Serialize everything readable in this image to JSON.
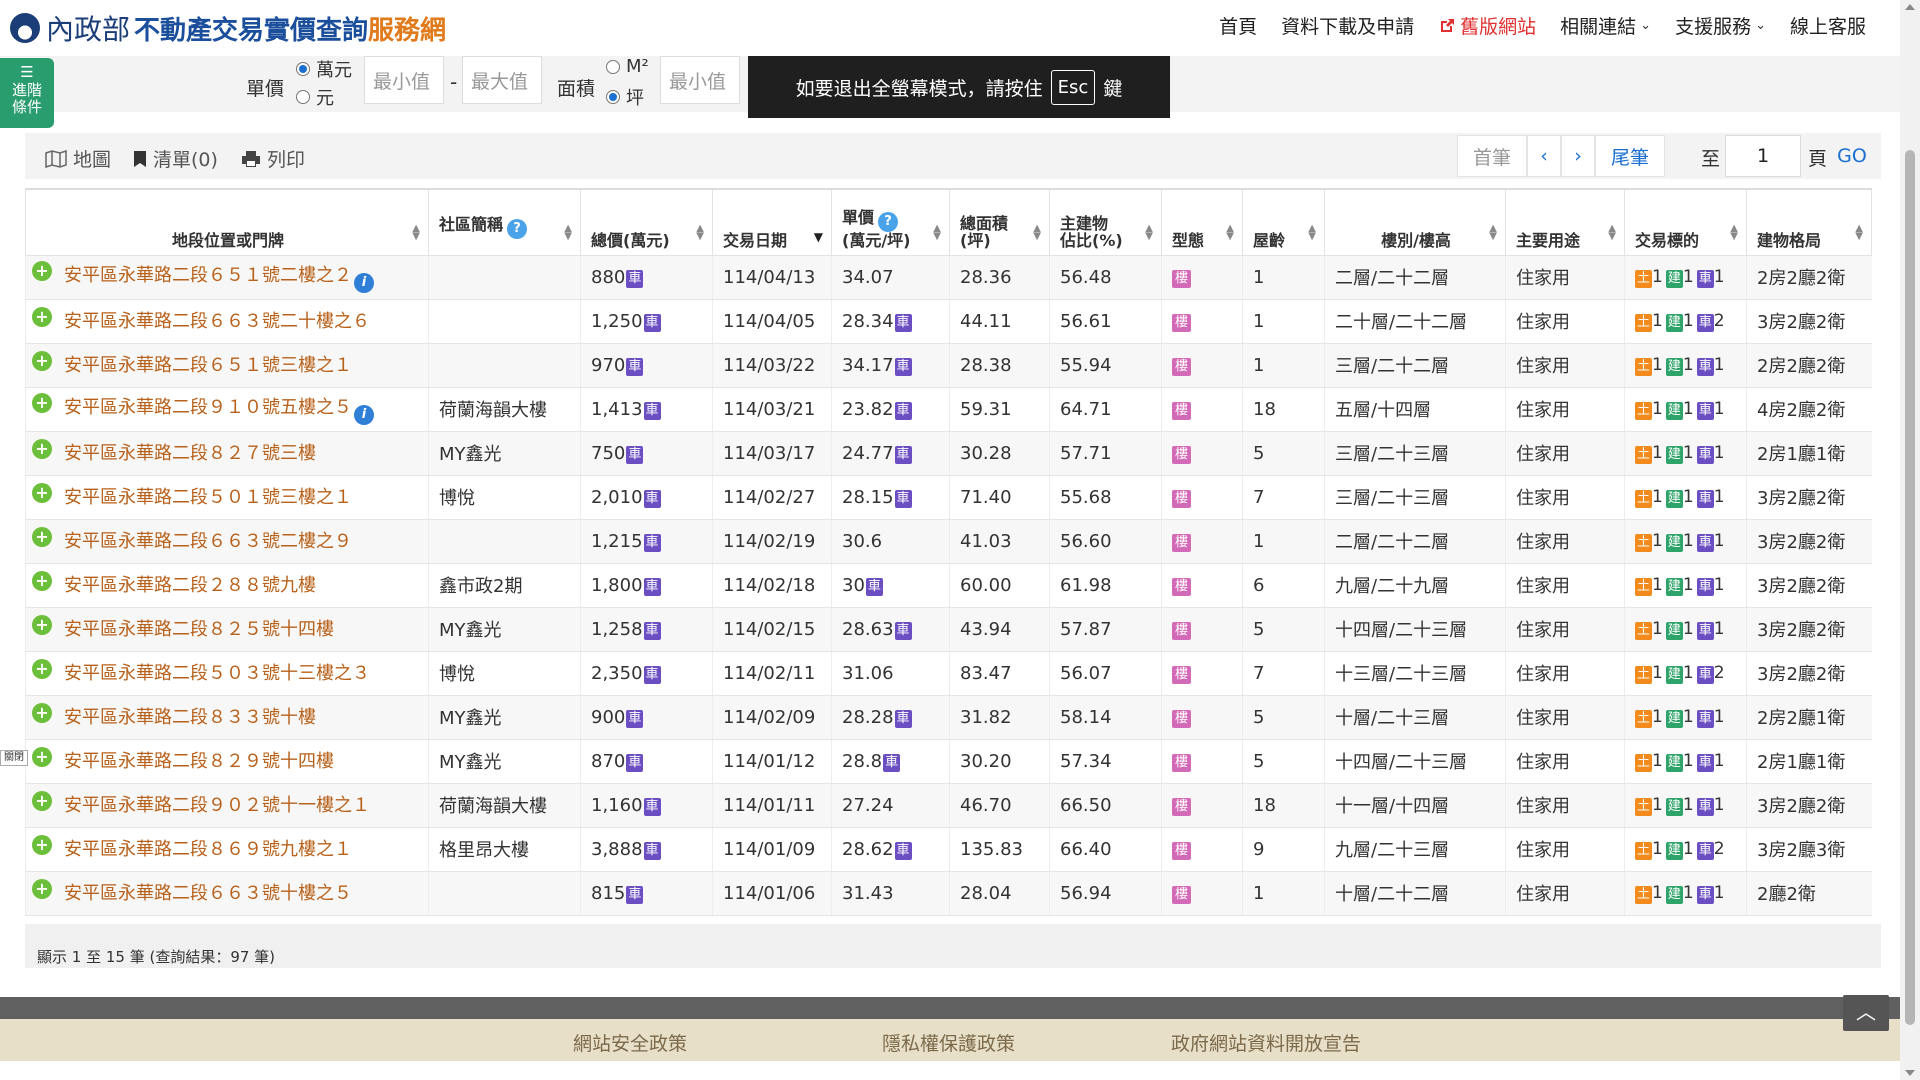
{
  "header": {
    "ministry": "內政部",
    "site_name": "不動產交易實價查詢",
    "site_suffix": "服務網",
    "nav": [
      {
        "label": "首頁"
      },
      {
        "label": "資料下載及申請"
      },
      {
        "label": "舊版網站"
      },
      {
        "label": "相關連結"
      },
      {
        "label": "支援服務"
      },
      {
        "label": "線上客服"
      }
    ]
  },
  "advanced": {
    "label_line1": "進階",
    "label_line2": "條件"
  },
  "filter": {
    "unit_price_label": "單價",
    "unit_wan": "萬元",
    "unit_yuan": "元",
    "min_placeholder": "最小值",
    "max_placeholder": "最大值",
    "dash": "-",
    "area_label": "面積",
    "area_m2": "M²",
    "area_ping": "坪",
    "area_min_placeholder": "最小值"
  },
  "fullscreen": {
    "text_before": "如要退出全螢幕模式，請按住",
    "key": "Esc",
    "text_after": "鍵"
  },
  "toolbar": {
    "map": "地圖",
    "list": "清單(0)",
    "print": "列印",
    "first": "首筆",
    "prev": "‹",
    "next": "›",
    "last": "尾筆",
    "to": "至",
    "page_value": "1",
    "page": "頁",
    "go": "GO"
  },
  "table": {
    "headers": {
      "address": "地段位置或門牌",
      "community": "社區簡稱",
      "total": "總價(萬元)",
      "date": "交易日期",
      "unit_line1": "單價",
      "unit_line2": "(萬元/坪)",
      "area_line1": "總面積",
      "area_line2": "(坪)",
      "main_line1": "主建物",
      "main_line2": "佔比(%)",
      "type": "型態",
      "age": "屋齡",
      "floor": "樓別/樓高",
      "usage": "主要用途",
      "target": "交易標的",
      "layout": "建物格局"
    },
    "badges": {
      "car": "車",
      "bldg": "樓",
      "land": "土",
      "build": "建"
    },
    "rows": [
      {
        "address": "安平區永華路二段６５１號二樓之２",
        "info": true,
        "community": "",
        "total": "880",
        "total_car": true,
        "date": "114/04/13",
        "unit": "34.07",
        "unit_car": false,
        "area": "28.36",
        "main": "56.48",
        "age": "1",
        "floor": "二層/二十二層",
        "usage": "住家用",
        "land": "1",
        "build": "1",
        "car": "1",
        "layout": "2房2廳2衛"
      },
      {
        "address": "安平區永華路二段６６３號二十樓之６",
        "info": false,
        "community": "",
        "total": "1,250",
        "total_car": true,
        "date": "114/04/05",
        "unit": "28.34",
        "unit_car": true,
        "area": "44.11",
        "main": "56.61",
        "age": "1",
        "floor": "二十層/二十二層",
        "usage": "住家用",
        "land": "1",
        "build": "1",
        "car": "2",
        "layout": "3房2廳2衛"
      },
      {
        "address": "安平區永華路二段６５１號三樓之１",
        "info": false,
        "community": "",
        "total": "970",
        "total_car": true,
        "date": "114/03/22",
        "unit": "34.17",
        "unit_car": true,
        "area": "28.38",
        "main": "55.94",
        "age": "1",
        "floor": "三層/二十二層",
        "usage": "住家用",
        "land": "1",
        "build": "1",
        "car": "1",
        "layout": "2房2廳2衛"
      },
      {
        "address": "安平區永華路二段９１０號五樓之５",
        "info": true,
        "community": "荷蘭海韻大樓",
        "total": "1,413",
        "total_car": true,
        "date": "114/03/21",
        "unit": "23.82",
        "unit_car": true,
        "area": "59.31",
        "main": "64.71",
        "age": "18",
        "floor": "五層/十四層",
        "usage": "住家用",
        "land": "1",
        "build": "1",
        "car": "1",
        "layout": "4房2廳2衛"
      },
      {
        "address": "安平區永華路二段８２７號三樓",
        "info": false,
        "community": "MY鑫光",
        "total": "750",
        "total_car": true,
        "date": "114/03/17",
        "unit": "24.77",
        "unit_car": true,
        "area": "30.28",
        "main": "57.71",
        "age": "5",
        "floor": "三層/二十三層",
        "usage": "住家用",
        "land": "1",
        "build": "1",
        "car": "1",
        "layout": "2房1廳1衛"
      },
      {
        "address": "安平區永華路二段５０１號三樓之１",
        "info": false,
        "community": "博悅",
        "total": "2,010",
        "total_car": true,
        "date": "114/02/27",
        "unit": "28.15",
        "unit_car": true,
        "area": "71.40",
        "main": "55.68",
        "age": "7",
        "floor": "三層/二十三層",
        "usage": "住家用",
        "land": "1",
        "build": "1",
        "car": "1",
        "layout": "3房2廳2衛"
      },
      {
        "address": "安平區永華路二段６６３號二樓之９",
        "info": false,
        "community": "",
        "total": "1,215",
        "total_car": true,
        "date": "114/02/19",
        "unit": "30.6",
        "unit_car": false,
        "area": "41.03",
        "main": "56.60",
        "age": "1",
        "floor": "二層/二十二層",
        "usage": "住家用",
        "land": "1",
        "build": "1",
        "car": "1",
        "layout": "3房2廳2衛"
      },
      {
        "address": "安平區永華路二段２８８號九樓",
        "info": false,
        "community": "鑫市政2期",
        "total": "1,800",
        "total_car": true,
        "date": "114/02/18",
        "unit": "30",
        "unit_car": true,
        "area": "60.00",
        "main": "61.98",
        "age": "6",
        "floor": "九層/二十九層",
        "usage": "住家用",
        "land": "1",
        "build": "1",
        "car": "1",
        "layout": "3房2廳2衛"
      },
      {
        "address": "安平區永華路二段８２５號十四樓",
        "info": false,
        "community": "MY鑫光",
        "total": "1,258",
        "total_car": true,
        "date": "114/02/15",
        "unit": "28.63",
        "unit_car": true,
        "area": "43.94",
        "main": "57.87",
        "age": "5",
        "floor": "十四層/二十三層",
        "usage": "住家用",
        "land": "1",
        "build": "1",
        "car": "1",
        "layout": "3房2廳2衛"
      },
      {
        "address": "安平區永華路二段５０３號十三樓之３",
        "info": false,
        "community": "博悅",
        "total": "2,350",
        "total_car": true,
        "date": "114/02/11",
        "unit": "31.06",
        "unit_car": false,
        "area": "83.47",
        "main": "56.07",
        "age": "7",
        "floor": "十三層/二十三層",
        "usage": "住家用",
        "land": "1",
        "build": "1",
        "car": "2",
        "layout": "3房2廳2衛"
      },
      {
        "address": "安平區永華路二段８３３號十樓",
        "info": false,
        "community": "MY鑫光",
        "total": "900",
        "total_car": true,
        "date": "114/02/09",
        "unit": "28.28",
        "unit_car": true,
        "area": "31.82",
        "main": "58.14",
        "age": "5",
        "floor": "十層/二十三層",
        "usage": "住家用",
        "land": "1",
        "build": "1",
        "car": "1",
        "layout": "2房2廳1衛"
      },
      {
        "address": "安平區永華路二段８２９號十四樓",
        "info": false,
        "community": "MY鑫光",
        "total": "870",
        "total_car": true,
        "date": "114/01/12",
        "unit": "28.8",
        "unit_car": true,
        "area": "30.20",
        "main": "57.34",
        "age": "5",
        "floor": "十四層/二十三層",
        "usage": "住家用",
        "land": "1",
        "build": "1",
        "car": "1",
        "layout": "2房1廳1衛"
      },
      {
        "address": "安平區永華路二段９０２號十一樓之１",
        "info": false,
        "community": "荷蘭海韻大樓",
        "total": "1,160",
        "total_car": true,
        "date": "114/01/11",
        "unit": "27.24",
        "unit_car": false,
        "area": "46.70",
        "main": "66.50",
        "age": "18",
        "floor": "十一層/十四層",
        "usage": "住家用",
        "land": "1",
        "build": "1",
        "car": "1",
        "layout": "3房2廳2衛"
      },
      {
        "address": "安平區永華路二段８６９號九樓之１",
        "info": false,
        "community": "格里昂大樓",
        "total": "3,888",
        "total_car": true,
        "date": "114/01/09",
        "unit": "28.62",
        "unit_car": true,
        "area": "135.83",
        "main": "66.40",
        "age": "9",
        "floor": "九層/二十三層",
        "usage": "住家用",
        "land": "1",
        "build": "1",
        "car": "2",
        "layout": "3房2廳3衛"
      },
      {
        "address": "安平區永華路二段６６３號十樓之５",
        "info": false,
        "community": "",
        "total": "815",
        "total_car": true,
        "date": "114/01/06",
        "unit": "31.43",
        "unit_car": false,
        "area": "28.04",
        "main": "56.94",
        "age": "1",
        "floor": "十層/二十二層",
        "usage": "住家用",
        "land": "1",
        "build": "1",
        "car": "1",
        "layout": "2廳2衛"
      }
    ]
  },
  "summary": "顯示 1 至 15 筆 (查詢結果：97 筆)",
  "footer": {
    "security": "網站安全政策",
    "privacy": "隱私權保護政策",
    "open_data": "政府網站資料開放宣告"
  },
  "close_tag": "關閉",
  "icons": {
    "emblem": "ministry-emblem-icon",
    "external": "external-link-icon",
    "map": "map-icon",
    "bookmark": "bookmark-icon",
    "print": "printer-icon",
    "filter": "sliders-icon",
    "plus": "plus-circle-icon",
    "info": "info-icon",
    "help": "question-icon",
    "up": "arrow-up-icon"
  }
}
